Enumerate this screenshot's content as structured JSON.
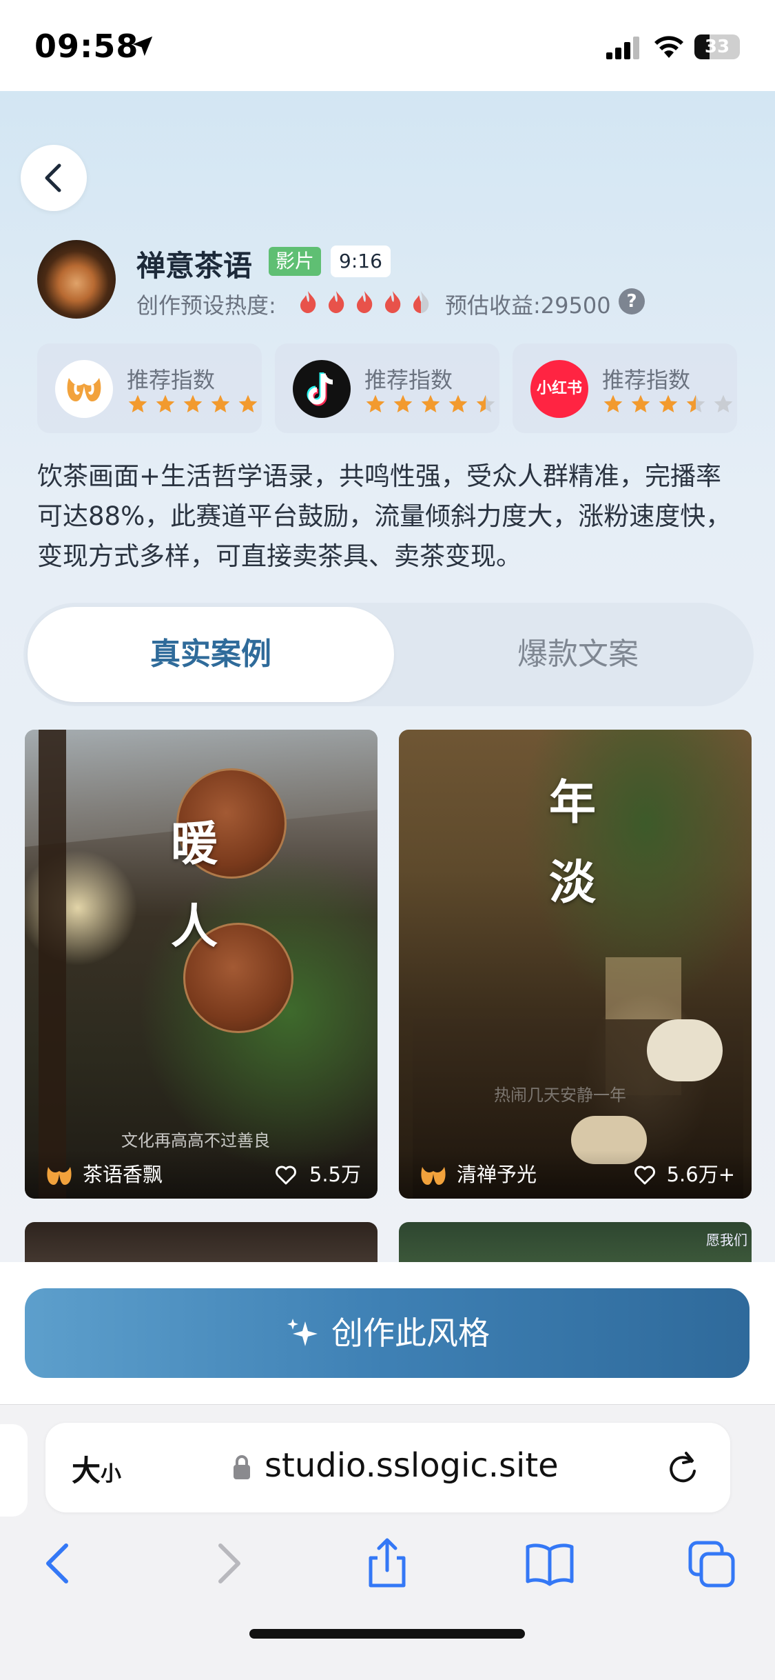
{
  "status_bar": {
    "time": "09:58",
    "battery": "33"
  },
  "header": {
    "title": "禅意茶语",
    "tag_type": "影片",
    "tag_ratio": "9:16",
    "heat_label": "创作预设热度:",
    "heat_level": 4.5,
    "heat_max": 5,
    "income_label": "预估收益:29500"
  },
  "platforms": [
    {
      "name": "kuaiying",
      "label": "推荐指数",
      "rating": 5
    },
    {
      "name": "douyin",
      "label": "推荐指数",
      "rating": 4.5
    },
    {
      "name": "xiaohongshu",
      "label": "推荐指数",
      "logo_text": "小红书",
      "rating": 3.5
    }
  ],
  "description": "饮茶画面+生活哲学语录，共鸣性强，受众人群精准，完播率可达88%，此赛道平台鼓励，流量倾斜力度大，涨粉速度快，变现方式多样，可直接卖茶具、卖茶变现。",
  "tabs": {
    "active": "真实案例",
    "inactive": "爆款文案"
  },
  "cases": [
    {
      "overlay_text": [
        "暖",
        "人"
      ],
      "caption": "文化再高高不过善良",
      "author": "茶语香飘",
      "likes": "5.5万"
    },
    {
      "overlay_text": [
        "年",
        "淡"
      ],
      "caption": "热闹几天安静一年",
      "author": "清禅予光",
      "likes": "5.6万+"
    },
    {
      "corner_text": "愿我们"
    }
  ],
  "cta": {
    "label": "创作此风格"
  },
  "browser": {
    "text_size_big": "大",
    "text_size_small": "小",
    "url": "studio.sslogic.site"
  },
  "colors": {
    "accent": "#3e80b4",
    "star": "#f29a2e",
    "flame": "#e8524a",
    "tag_green": "#5fbf73"
  }
}
